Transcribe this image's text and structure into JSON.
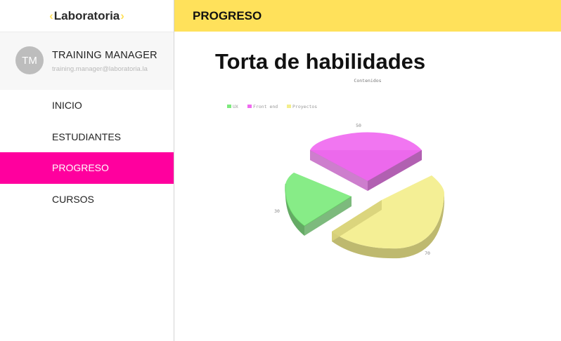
{
  "sidebar": {
    "logo": "Laboratoria",
    "logo_left": "‹",
    "logo_right": "›",
    "user": {
      "initials": "TM",
      "name": "TRAINING MANAGER",
      "email": "training.manager@laboratoria.la"
    },
    "nav": [
      "INICIO",
      "ESTUDIANTES",
      "PROGRESO",
      "CURSOS"
    ],
    "active_nav": "PROGRESO"
  },
  "header": {
    "title": "PROGRESO"
  },
  "main": {
    "title": "Torta de habilidades"
  },
  "colors": {
    "accent_yellow": "#ffe15b",
    "active_pink": "#ff009e"
  },
  "chart_data": {
    "type": "pie",
    "title": "Contenidos",
    "legend_position": "top-left",
    "series": [
      {
        "name": "UX",
        "value": 30,
        "label": "30",
        "color": "#7dea7d"
      },
      {
        "name": "Front end",
        "value": 50,
        "label": "50",
        "color": "#f06af0"
      },
      {
        "name": "Proyectos",
        "value": 70,
        "label": "70",
        "color": "#f3ee8c"
      }
    ]
  }
}
